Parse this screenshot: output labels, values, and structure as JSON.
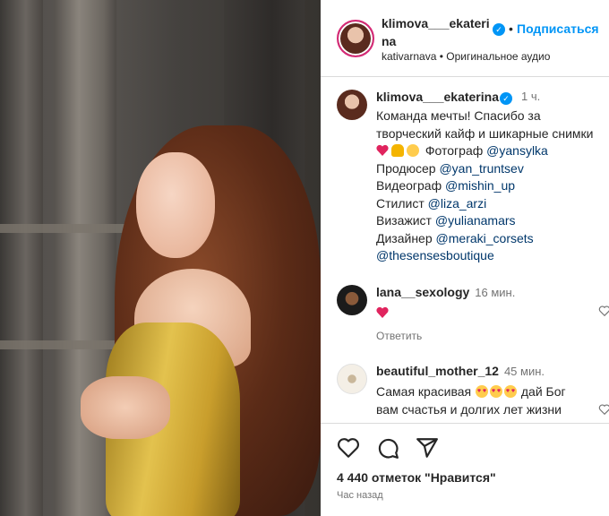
{
  "header": {
    "username_line1": "klimova___ekateri",
    "username_line2": "na",
    "separator": "•",
    "follow_label": "Подписаться",
    "subtitle": "kativarnava • Оригинальное аудио"
  },
  "caption": {
    "username": "klimova___ekaterina",
    "time": "1 ч.",
    "line1": "Команда мечты! Спасибо за",
    "line2": "творческий кайф и шикарные снимки",
    "photographer_label": "Фотограф",
    "photographer": "@yansylka",
    "producer_label": "Продюсер",
    "producer": "@yan_truntsev",
    "videographer_label": "Видеограф",
    "videographer": "@mishin_up",
    "stylist_label": "Стилист",
    "stylist": "@liza_arzi",
    "makeup_label": "Визажист",
    "makeup": "@yulianamars",
    "designer_label": "Дизайнер",
    "designer": "@meraki_corsets",
    "boutique": "@thesensesboutique"
  },
  "comments": [
    {
      "username": "lana__sexology",
      "time": "16 мин.",
      "reply": "Ответить"
    },
    {
      "username": "beautiful_mother_12",
      "time": "45 мин.",
      "text_start": "Самая красивая",
      "text_end": "дай Бог",
      "text_line2": "вам счастья и долгих лет жизни"
    }
  ],
  "footer": {
    "likes": "4 440 отметок \"Нравится\"",
    "posted": "Час назад"
  },
  "colors": {
    "link": "#0095f6",
    "mention": "#00376b",
    "verified": "#0095f6",
    "heart": "#e0245e"
  },
  "icons": [
    "verified-badge-icon",
    "heart-icon",
    "comment-icon",
    "share-icon",
    "heart-outline-icon"
  ]
}
